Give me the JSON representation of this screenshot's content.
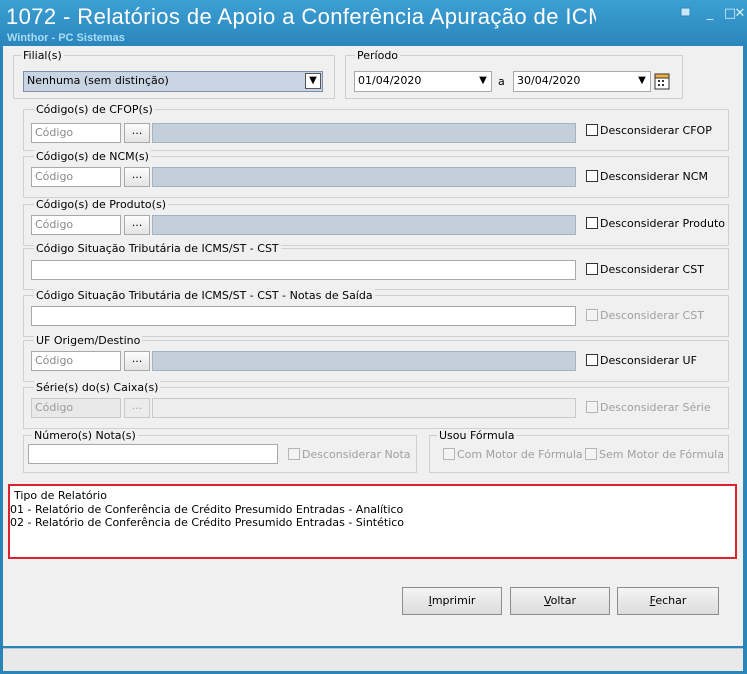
{
  "window": {
    "title": "1072 - Relatórios de Apoio a Conferência Apuração de ICM",
    "subtitle": "Winthor - PC Sistemas",
    "minimize": "_",
    "maximize": "□",
    "close": "✕",
    "restore_icon": "restore-icon"
  },
  "filial": {
    "label": "Filial(s)",
    "value": "Nenhuma (sem distinção)",
    "arrow": "▼"
  },
  "periodo": {
    "label": "Período",
    "start": "01/04/2020",
    "separator": "a",
    "end": "30/04/2020",
    "arrow": "▼"
  },
  "filters": [
    {
      "label": "Código(s) de CFOP(s)",
      "placeholder": "Código",
      "ellipsis": "...",
      "exclude_label": "Desconsiderar CFOP"
    },
    {
      "label": "Código(s) de NCM(s)",
      "placeholder": "Código",
      "ellipsis": "...",
      "exclude_label": "Desconsiderar NCM"
    },
    {
      "label": "Código(s) de Produto(s)",
      "placeholder": "Código",
      "ellipsis": "...",
      "exclude_label": "Desconsiderar Produto"
    }
  ],
  "cst": {
    "label": "Código Situação Tributária de ICMS/ST - CST",
    "value": "",
    "exclude_label": "Desconsiderar CST"
  },
  "cst_saida": {
    "label": "Código Situação Tributária de ICMS/ST - CST -  Notas de Saída",
    "value": "",
    "exclude_label": "Desconsiderar CST"
  },
  "uf": {
    "label": "UF Origem/Destino",
    "placeholder": "Código",
    "ellipsis": "...",
    "exclude_label": "Desconsiderar UF"
  },
  "serie": {
    "label": "Série(s) do(s) Caixa(s)",
    "placeholder": "Código",
    "ellipsis": "...",
    "exclude_label": "Desconsiderar Série"
  },
  "nota": {
    "label": "Número(s) Nota(s)",
    "value": "",
    "exclude_label": "Desconsiderar Nota"
  },
  "formula": {
    "label": "Usou Fórmula",
    "option_with": "Com Motor de Fórmula",
    "option_without": "Sem Motor de Fórmula"
  },
  "report_type": {
    "label": "Tipo de Relatório",
    "items": [
      "01 - Relatório de Conferência de Crédito Presumido Entradas - Analítico",
      "02 - Relatório de Conferência de Crédito Presumido Entradas - Sintético"
    ],
    "highlight_color": "#d9232f"
  },
  "buttons": {
    "print": {
      "access_key": "I",
      "rest": "mprimir"
    },
    "back": {
      "access_key": "V",
      "rest": "oltar"
    },
    "close": {
      "access_key": "F",
      "rest": "echar"
    }
  },
  "colors": {
    "titlebar": "#2a86bd",
    "client": "#f0f0f0",
    "accent_red": "#d9232f"
  }
}
